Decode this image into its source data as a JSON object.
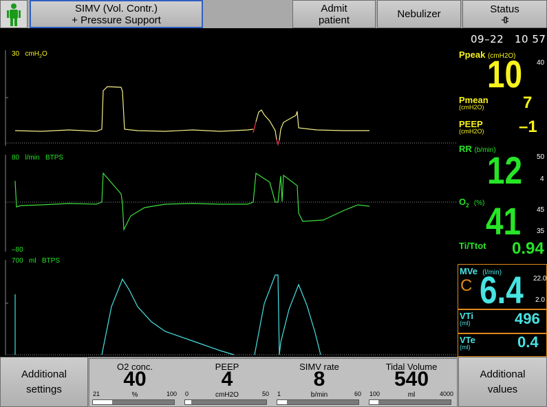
{
  "top_bar": {
    "mode_line1": "SIMV (Vol. Contr.)",
    "mode_line2": "+ Pressure Support",
    "admit_line1": "Admit",
    "admit_line2": "patient",
    "nebulizer": "Nebulizer",
    "status": "Status",
    "status_icon": "connector-icon",
    "patient_icon": "adult-patient-icon"
  },
  "clock": {
    "date": "09–22",
    "time": "10 57"
  },
  "waveforms": {
    "pressure": {
      "scale": "30",
      "unit": "cmH",
      "unit_sub": "2",
      "unit_tail": "O",
      "color": "#f7f31c"
    },
    "flow": {
      "scale": "80",
      "unit": "l/min",
      "tag": "BTPS",
      "min": "–80",
      "color": "#27e527"
    },
    "volume": {
      "scale": "700",
      "unit": "ml",
      "tag": "BTPS",
      "color": "#48e3e3"
    }
  },
  "measurements": {
    "ppeak": {
      "label": "Ppeak",
      "unit": "(cmH2O)",
      "value": "10",
      "high": "40"
    },
    "pmean": {
      "label": "Pmean",
      "unit": "(cmH2O)",
      "value": "7"
    },
    "peep": {
      "label": "PEEP",
      "unit": "(cmH2O)",
      "value": "–1"
    },
    "rr": {
      "label": "RR",
      "unit": "(b/min)",
      "value": "12",
      "high": "50",
      "low": "4"
    },
    "o2": {
      "label": "O",
      "label_sub": "2",
      "unit": "(%)",
      "value": "41",
      "high": "45",
      "low": "35"
    },
    "titot": {
      "label": "Ti/Ttot",
      "value": "0.94"
    },
    "mve": {
      "label": "MVe",
      "unit": "(l/min)",
      "value": "6.4",
      "high": "22.0",
      "low": "2.0",
      "flag": "C"
    },
    "vti": {
      "label": "VTi",
      "unit": "(ml)",
      "value": "496"
    },
    "vte": {
      "label": "VTe",
      "unit": "(ml)",
      "value": "0.4"
    }
  },
  "bottom_bar": {
    "additional_settings_line1": "Additional",
    "additional_settings_line2": "settings",
    "additional_values_line1": "Additional",
    "additional_values_line2": "values",
    "settings": [
      {
        "name": "O2 conc.",
        "value": "40",
        "unit": "%",
        "min": "21",
        "max": "100",
        "level": 0.24
      },
      {
        "name": "PEEP",
        "value": "4",
        "unit": "cmH2O",
        "min": "0",
        "max": "50",
        "level": 0.08
      },
      {
        "name": "SIMV rate",
        "value": "8",
        "unit": "b/min",
        "min": "1",
        "max": "60",
        "level": 0.12
      },
      {
        "name": "Tidal Volume",
        "value": "540",
        "unit": "ml",
        "min": "100",
        "max": "4000",
        "level": 0.11
      }
    ]
  }
}
